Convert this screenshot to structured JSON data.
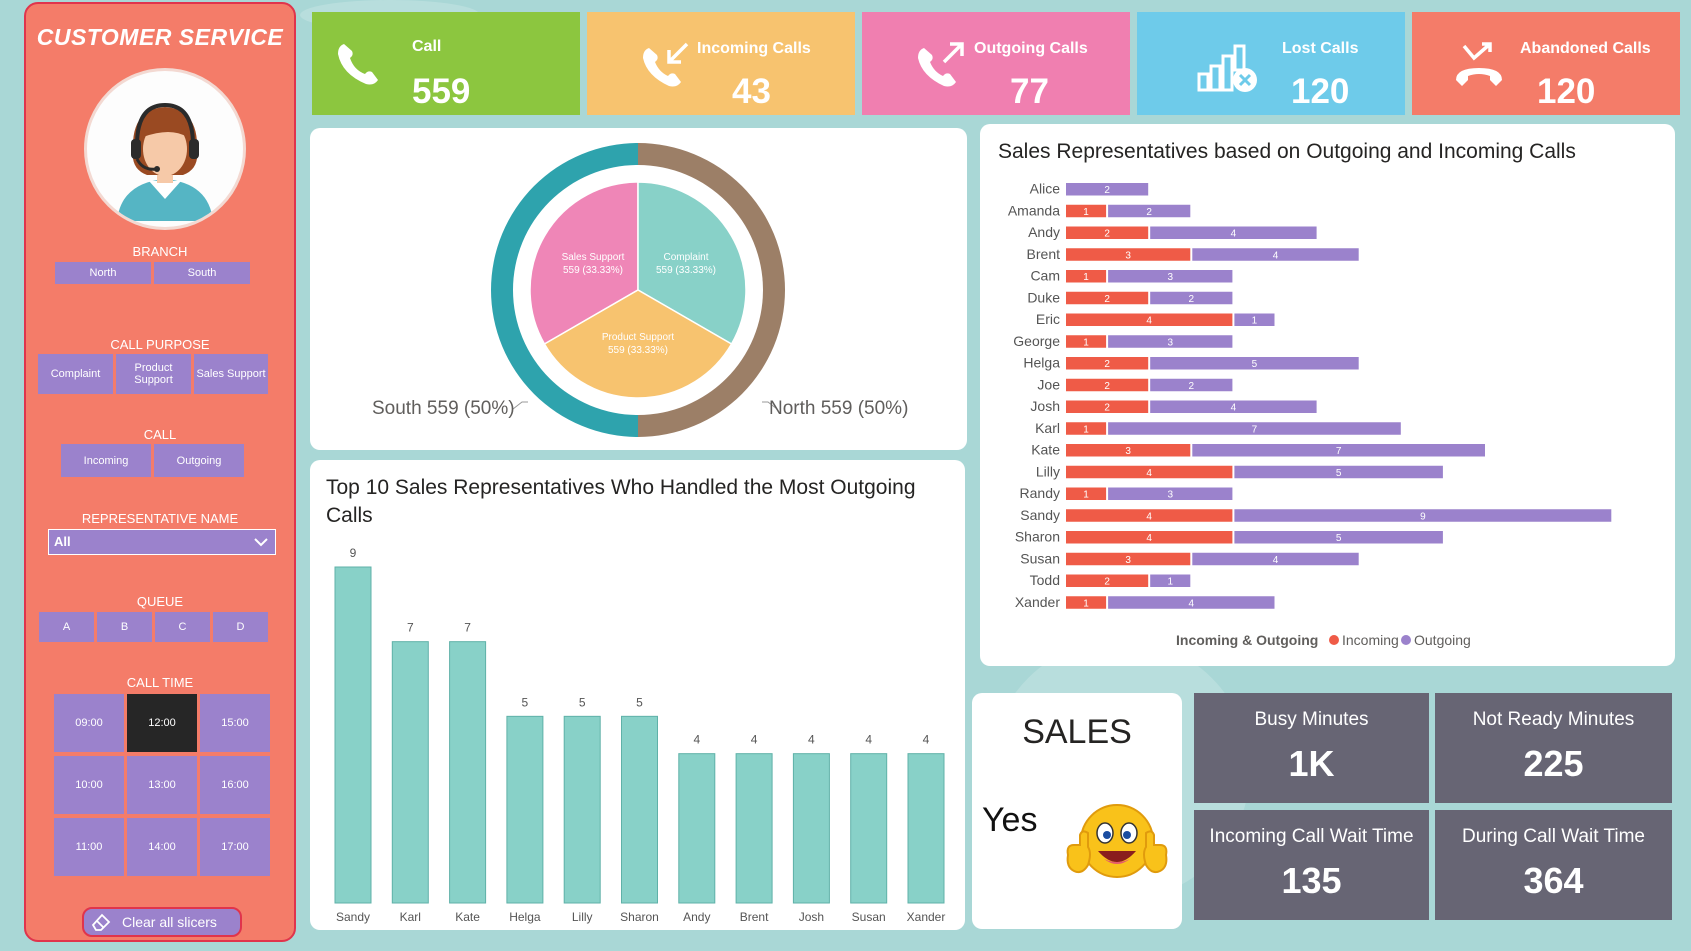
{
  "sidebar": {
    "title": "CUSTOMER SERVICE",
    "branch": {
      "label": "BRANCH",
      "options": [
        "North",
        "South"
      ]
    },
    "call_purpose": {
      "label": "CALL PURPOSE",
      "options": [
        "Complaint",
        "Product Support",
        "Sales Support"
      ]
    },
    "call": {
      "label": "CALL",
      "options": [
        "Incoming",
        "Outgoing"
      ]
    },
    "representative": {
      "label": "REPRESENTATIVE NAME",
      "selected": "All"
    },
    "queue": {
      "label": "QUEUE",
      "options": [
        "A",
        "B",
        "C",
        "D"
      ]
    },
    "call_time": {
      "label": "CALL TIME",
      "options": [
        "09:00",
        "12:00",
        "15:00",
        "10:00",
        "13:00",
        "16:00",
        "11:00",
        "14:00",
        "17:00"
      ],
      "selected": "12:00"
    },
    "clear_label": "Clear all slicers"
  },
  "kpis": [
    {
      "label": "Call",
      "value": "559",
      "color": "#8cc63f",
      "icon": "phone-icon"
    },
    {
      "label": "Incoming Calls",
      "value": "43",
      "color": "#f7c36f",
      "icon": "incoming-call-icon"
    },
    {
      "label": "Outgoing Calls",
      "value": "77",
      "color": "#f07fb0",
      "icon": "outgoing-call-icon"
    },
    {
      "label": "Lost Calls",
      "value": "120",
      "color": "#6ecbea",
      "icon": "lost-calls-chart-icon"
    },
    {
      "label": "Abandoned Calls",
      "value": "120",
      "color": "#f47c69",
      "icon": "abandoned-call-icon"
    }
  ],
  "donut": {
    "outer_labels": [
      "South 559 (50%)",
      "North 559 (50%)"
    ],
    "inner_labels": [
      [
        "Sales Support",
        "559 (33.33%)"
      ],
      [
        "Complaint",
        "559 (33.33%)"
      ],
      [
        "Product Support",
        "559 (33.33%)"
      ]
    ]
  },
  "top10": {
    "title": "Top 10 Sales Representatives Who Handled the Most Outgoing Calls"
  },
  "reps_chart": {
    "title": "Sales Representatives based on Outgoing and Incoming Calls"
  },
  "sales": {
    "title": "SALES",
    "value": "Yes"
  },
  "metrics": [
    {
      "label": "Busy Minutes",
      "value": "1K"
    },
    {
      "label": "Not Ready Minutes",
      "value": "225"
    },
    {
      "label": "Incoming Call Wait Time",
      "value": "135"
    },
    {
      "label": "During Call Wait Time",
      "value": "364"
    }
  ],
  "colors": {
    "incoming": "#ef5b47",
    "outgoing": "#9b82cc",
    "bar": "#88d1c8",
    "south": "#2ea3ad",
    "north": "#9c7f67"
  },
  "chart_data": [
    {
      "type": "pie",
      "ring": "Branch",
      "slices": [
        {
          "label": "South",
          "value": 559,
          "pct": "50%"
        },
        {
          "label": "North",
          "value": 559,
          "pct": "50%"
        }
      ],
      "inner": [
        {
          "label": "Sales Support",
          "value": 559,
          "pct": "33.33%"
        },
        {
          "label": "Complaint",
          "value": 559,
          "pct": "33.33%"
        },
        {
          "label": "Product Support",
          "value": 559,
          "pct": "33.33%"
        }
      ]
    },
    {
      "type": "bar",
      "title": "Top 10 Sales Representatives Who Handled the Most Outgoing Calls",
      "categories": [
        "Sandy",
        "Karl",
        "Kate",
        "Helga",
        "Lilly",
        "Sharon",
        "Andy",
        "Brent",
        "Josh",
        "Susan",
        "Xander"
      ],
      "values": [
        9,
        7,
        7,
        5,
        5,
        5,
        4,
        4,
        4,
        4,
        4
      ],
      "ylim": [
        0,
        9
      ]
    },
    {
      "type": "bar",
      "orientation": "horizontal",
      "title": "Sales Representatives based on Outgoing and Incoming Calls",
      "legend_title": "Incoming & Outgoing",
      "legend_position": "bottom",
      "categories": [
        "Alice",
        "Amanda",
        "Andy",
        "Brent",
        "Cam",
        "Duke",
        "Eric",
        "George",
        "Helga",
        "Joe",
        "Josh",
        "Karl",
        "Kate",
        "Lilly",
        "Randy",
        "Sandy",
        "Sharon",
        "Susan",
        "Todd",
        "Xander"
      ],
      "series": [
        {
          "name": "Incoming",
          "values": [
            null,
            1,
            2,
            3,
            1,
            2,
            4,
            1,
            2,
            2,
            2,
            1,
            3,
            4,
            1,
            4,
            4,
            3,
            2,
            1
          ]
        },
        {
          "name": "Outgoing",
          "values": [
            2,
            2,
            4,
            4,
            3,
            2,
            1,
            3,
            5,
            2,
            4,
            7,
            7,
            5,
            3,
            9,
            5,
            4,
            1,
            4
          ]
        }
      ]
    }
  ]
}
